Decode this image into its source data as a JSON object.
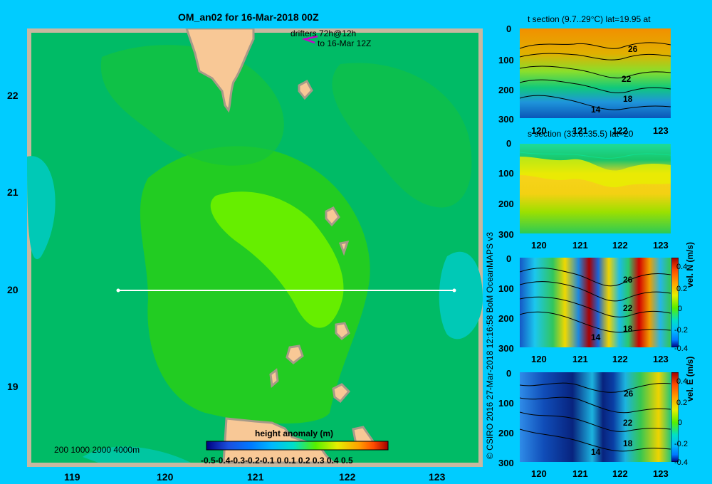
{
  "title": "OM_an02 for 16-Mar-2018 00Z",
  "map": {
    "lat_ticks": [
      "22",
      "21",
      "20",
      "19"
    ],
    "lon_ticks": [
      "119",
      "120",
      "121",
      "122",
      "123"
    ],
    "drifter_note_line1": "drifters 72h@12h",
    "drifter_note_line2": "to 16-Mar 12Z",
    "depth_scale": "200 1000 2000 4000m",
    "legend_title": "height anomaly (m)",
    "legend_ticks": [
      "-0.5",
      "-0.4",
      "-0.3",
      "-0.2",
      "-0.1",
      "0",
      "0.1",
      "0.2",
      "0.3",
      "0.4",
      "0.5"
    ],
    "section_lat": "20"
  },
  "panels": {
    "t_section": {
      "title": "t section (9.7..29°C) lat=19.95 at",
      "y_ticks": [
        "0",
        "100",
        "200",
        "300"
      ],
      "x_ticks": [
        "120",
        "121",
        "122",
        "123"
      ],
      "contours": [
        "26",
        "22",
        "18",
        "14"
      ]
    },
    "s_section": {
      "title": "s section (33.6..35.5) lat=20",
      "y_ticks": [
        "0",
        "100",
        "200",
        "300"
      ],
      "x_ticks": [
        "120",
        "121",
        "122",
        "123"
      ]
    },
    "vn_section": {
      "title": "vel. N (m/s)",
      "y_ticks": [
        "0",
        "100",
        "200",
        "300"
      ],
      "x_ticks": [
        "120",
        "121",
        "122",
        "123"
      ],
      "colorbar": [
        "0.4",
        "0.2",
        "0",
        "-0.2",
        "-0.4"
      ],
      "contours": [
        "26",
        "22",
        "18",
        "14"
      ]
    },
    "ve_section": {
      "title": "vel. E (m/s)",
      "y_ticks": [
        "0",
        "100",
        "200",
        "300"
      ],
      "x_ticks": [
        "120",
        "121",
        "122",
        "123"
      ],
      "colorbar": [
        "0.4",
        "0.2",
        "0",
        "-0.2",
        "-0.4"
      ],
      "contours": [
        "26",
        "22",
        "18",
        "14"
      ]
    }
  },
  "credit": "© CSIRO 2016   27-Mar-2018 12:16:58 BoM OceanMAPS v3",
  "colors": {
    "background": "#00ccff",
    "land": "#f8c896",
    "map_dark": "#00bb66",
    "map_mid": "#22cc22",
    "map_light": "#66ee00",
    "section_line": "#ffffff",
    "purple": "#cc00cc"
  }
}
